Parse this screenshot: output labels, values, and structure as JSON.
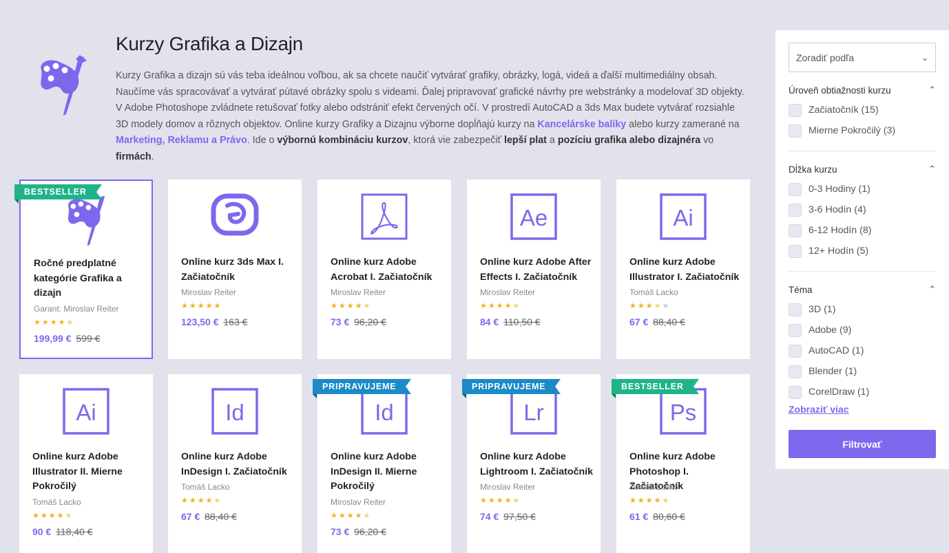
{
  "header": {
    "title": "Kurzy Grafika a Dizajn",
    "intro": {
      "p1": "Kurzy Grafika a dizajn sú vás teba ideálnou voľbou, ak sa chcete naučiť vytvárať grafiky, obrázky, logá, videá a ďalší multimediálny obsah. Naučíme vás spracovávať a vytvárať pútavé obrázky spolu s videami. Ďalej pripravovať grafické návrhy pre webstránky a modelovať 3D objekty. V Adobe Photoshope zvládnete retušovať fotky alebo odstrániť efekt červených očí. V prostredí AutoCAD a 3ds Max budete vytvárať rozsiahle 3D modely domov a rôznych objektov. Online kurzy Grafiky a Dizajnu výborne dopĺňajú kurzy na ",
      "link1": "Kancelárske balíky",
      "p2": " alebo kurzy zamerané na ",
      "link2": "Marketing, Reklamu a Právo",
      "p3": ". Ide o ",
      "b1": "výbornú kombináciu kurzov",
      "p4": ", ktorá vie zabezpečiť ",
      "b2": "lepší plat",
      "p5": " a ",
      "b3": "pozíciu grafika alebo dizajnéra",
      "p6": " vo ",
      "b4": "firmách",
      "p7": "."
    }
  },
  "colors": {
    "accent": "#7d68ed",
    "bestseller": "#1fb389",
    "upcoming": "#1b8ac6",
    "star": "#f2b01e"
  },
  "courses": [
    {
      "title": "Ročné predplatné kategórie Grafika a dizajn",
      "author": "Garant: Miroslav Reiter",
      "price": "199,99 €",
      "old_price": "599 €",
      "rating": 4.5,
      "ribbon": "BESTSELLER",
      "icon": "palette-icon"
    },
    {
      "title": "Online kurz 3ds Max I. Začiatočník",
      "author": "Miroslav Reiter",
      "price": "123,50 €",
      "old_price": "163 €",
      "rating": 5,
      "ribbon": "",
      "icon": "3ds-max-icon"
    },
    {
      "title": "Online kurz Adobe Acrobat I. Začiatočník",
      "author": "Miroslav Reiter",
      "price": "73 €",
      "old_price": "96,20 €",
      "rating": 4.5,
      "ribbon": "",
      "icon": "acrobat-icon"
    },
    {
      "title": "Online kurz Adobe After Effects I. Začiatočník",
      "author": "Miroslav Reiter",
      "price": "84 €",
      "old_price": "110,50 €",
      "rating": 4.5,
      "ribbon": "",
      "icon": "after-effects-icon",
      "code": "Ae"
    },
    {
      "title": "Online kurz Adobe Illustrator I. Začiatočník",
      "author": "Tomáš Lacko",
      "price": "67 €",
      "old_price": "88,40 €",
      "rating": 3.5,
      "ribbon": "",
      "icon": "illustrator-icon",
      "code": "Ai"
    },
    {
      "title": "Online kurz Adobe Illustrator II. Mierne Pokročilý",
      "author": "Tomáš Lacko",
      "price": "90 €",
      "old_price": "118,40 €",
      "rating": 4.5,
      "ribbon": "",
      "icon": "illustrator-icon",
      "code": "Ai"
    },
    {
      "title": "Online kurz Adobe InDesign I. Začiatočník",
      "author": "Tomáš Lacko",
      "price": "67 €",
      "old_price": "88,40 €",
      "rating": 4.5,
      "ribbon": "",
      "icon": "indesign-icon",
      "code": "Id"
    },
    {
      "title": "Online kurz Adobe InDesign II. Mierne Pokročilý",
      "author": "Miroslav Reiter",
      "price": "73 €",
      "old_price": "96,20 €",
      "rating": 4.5,
      "ribbon": "PRIPRAVUJEME",
      "icon": "indesign-icon",
      "code": "Id"
    },
    {
      "title": "Online kurz Adobe Lightroom I. Začiatočník",
      "author": "Miroslav Reiter",
      "price": "74 €",
      "old_price": "97,50 €",
      "rating": 4.5,
      "ribbon": "PRIPRAVUJEME",
      "icon": "lightroom-icon",
      "code": "Lr"
    },
    {
      "title": "Online kurz Adobe Photoshop I. Začiatočník",
      "author": "Tomáš Lacko",
      "price": "61 €",
      "old_price": "80,60 €",
      "rating": 4.5,
      "ribbon": "BESTSELLER",
      "icon": "photoshop-icon",
      "code": "Ps"
    }
  ],
  "sidebar": {
    "sort_label": "Zoradiť podľa",
    "groups": [
      {
        "title": "Úroveň obtiažnosti kurzu",
        "options": [
          "Začiatočník (15)",
          "Mierne Pokročilý (3)"
        ]
      },
      {
        "title": "Dĺžka kurzu",
        "options": [
          "0-3 Hodiny (1)",
          "3-6 Hodín (4)",
          "6-12 Hodín (8)",
          "12+ Hodín (5)"
        ]
      },
      {
        "title": "Téma",
        "options": [
          "3D (1)",
          "Adobe (9)",
          "AutoCAD (1)",
          "Blender (1)",
          "CorelDraw (1)"
        ]
      }
    ],
    "show_more": "Zobraziť viac",
    "filter_button": "Filtrovať"
  }
}
